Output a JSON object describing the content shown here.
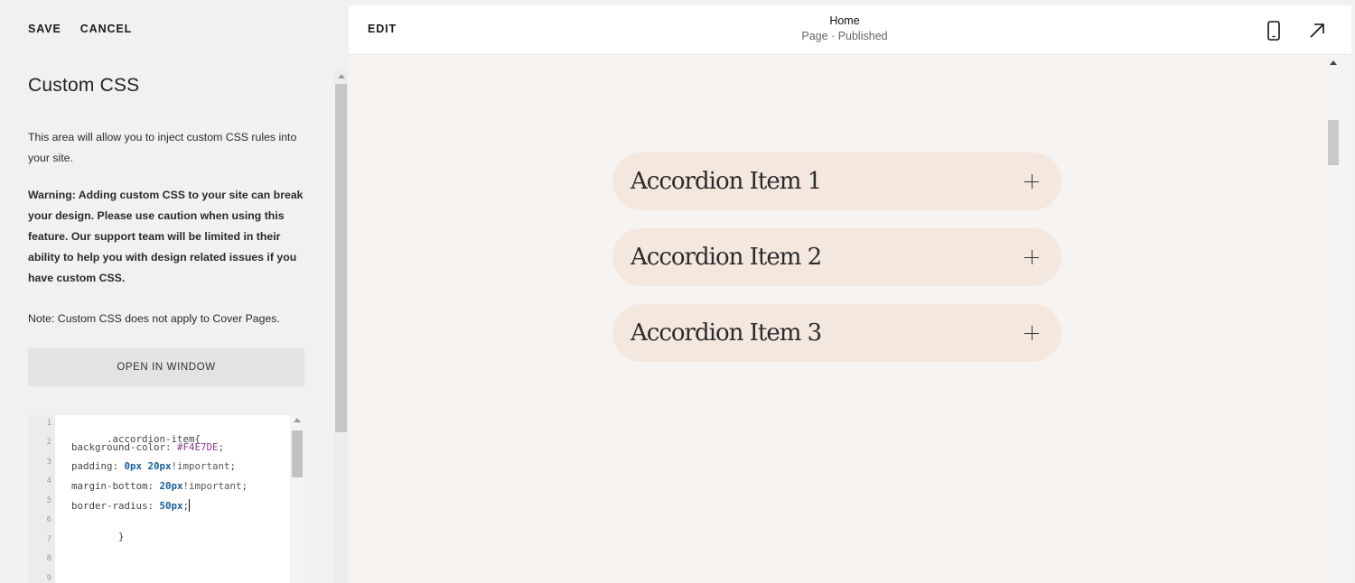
{
  "top_actions": {
    "save": "SAVE",
    "cancel": "CANCEL"
  },
  "panel": {
    "title": "Custom CSS",
    "description": "This area will allow you to inject custom CSS rules into your site.",
    "warning": "Warning: Adding custom CSS to your site can break your design. Please use caution when using this feature. Our support team will be limited in their ability to help you with design related issues if you have custom CSS.",
    "note": "Note: Custom CSS does not apply to Cover Pages.",
    "open_window_label": "OPEN IN WINDOW"
  },
  "editor": {
    "line_numbers": [
      "1",
      "2",
      "3",
      "4",
      "5",
      "6",
      "7",
      "8",
      "9"
    ],
    "lines": {
      "l1": ".accordion-item{",
      "l2_prop": "  background-color: ",
      "l2_val": "#F4E7DE",
      "l2_end": ";",
      "l3_prop": "  padding: ",
      "l3_val": "0px 20px",
      "l3_imp": "!important",
      "l3_end": ";",
      "l4_prop": "  margin-bottom: ",
      "l4_val": "20px",
      "l4_imp": "!important",
      "l4_end": ";",
      "l5_prop": "  border-radius: ",
      "l5_val": "50px",
      "l5_end": ";",
      "l6": "  }"
    }
  },
  "preview": {
    "edit_label": "EDIT",
    "page_name": "Home",
    "page_status": "Page · Published",
    "accordion_items": [
      "Accordion Item 1",
      "Accordion Item 2",
      "Accordion Item 3"
    ],
    "accordion_bg": "#F4E7DE"
  },
  "icons": {
    "mobile": "mobile-phone-icon",
    "expand": "expand-arrow-icon",
    "plus": "plus-icon"
  }
}
